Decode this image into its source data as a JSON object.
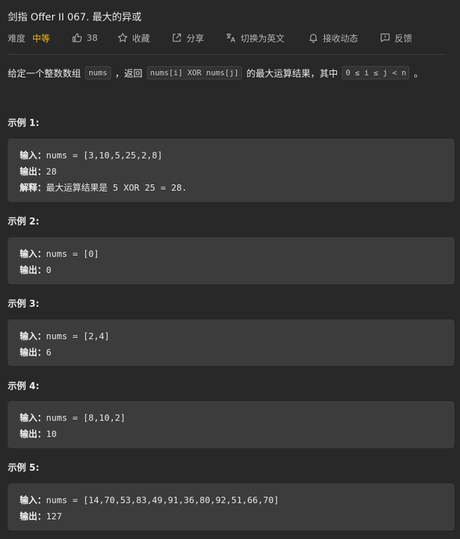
{
  "problem": {
    "title": "剑指 Offer II 067. 最大的异或"
  },
  "meta": {
    "difficulty_label": "难度",
    "difficulty_value": "中等",
    "likes": "38",
    "favorite": "收藏",
    "share": "分享",
    "translate": "切换为英文",
    "subscribe": "接收动态",
    "feedback": "反馈",
    "colors": {
      "difficulty": "#ffb800",
      "background": "#282828",
      "example_box": "#3c3c3c"
    },
    "icons": [
      "thumb-up-icon",
      "star-icon",
      "share-icon",
      "translate-icon",
      "bell-icon",
      "feedback-icon"
    ]
  },
  "description": {
    "part1": "给定一个整数数组",
    "code1": "nums",
    "part2": "，返回",
    "code2": "nums[i] XOR nums[j]",
    "part3": "的最大运算结果，其中",
    "code3": "0 ≤ i ≤ j < n",
    "part4": "。"
  },
  "examples": [
    {
      "label": "示例 1:",
      "input_key": "输入：",
      "input": "nums = [3,10,5,25,2,8]",
      "output_key": "输出：",
      "output": "28",
      "explain_key": "解释：",
      "explain": "最大运算结果是 5 XOR 25 = 28."
    },
    {
      "label": "示例 2:",
      "input_key": "输入：",
      "input": "nums = [0]",
      "output_key": "输出：",
      "output": "0"
    },
    {
      "label": "示例 3:",
      "input_key": "输入：",
      "input": "nums = [2,4]",
      "output_key": "输出：",
      "output": "6"
    },
    {
      "label": "示例 4:",
      "input_key": "输入：",
      "input": "nums = [8,10,2]",
      "output_key": "输出：",
      "output": "10"
    },
    {
      "label": "示例 5:",
      "input_key": "输入：",
      "input": "nums = [14,70,53,83,49,91,36,80,92,51,66,70]",
      "output_key": "输出：",
      "output": "127"
    }
  ]
}
